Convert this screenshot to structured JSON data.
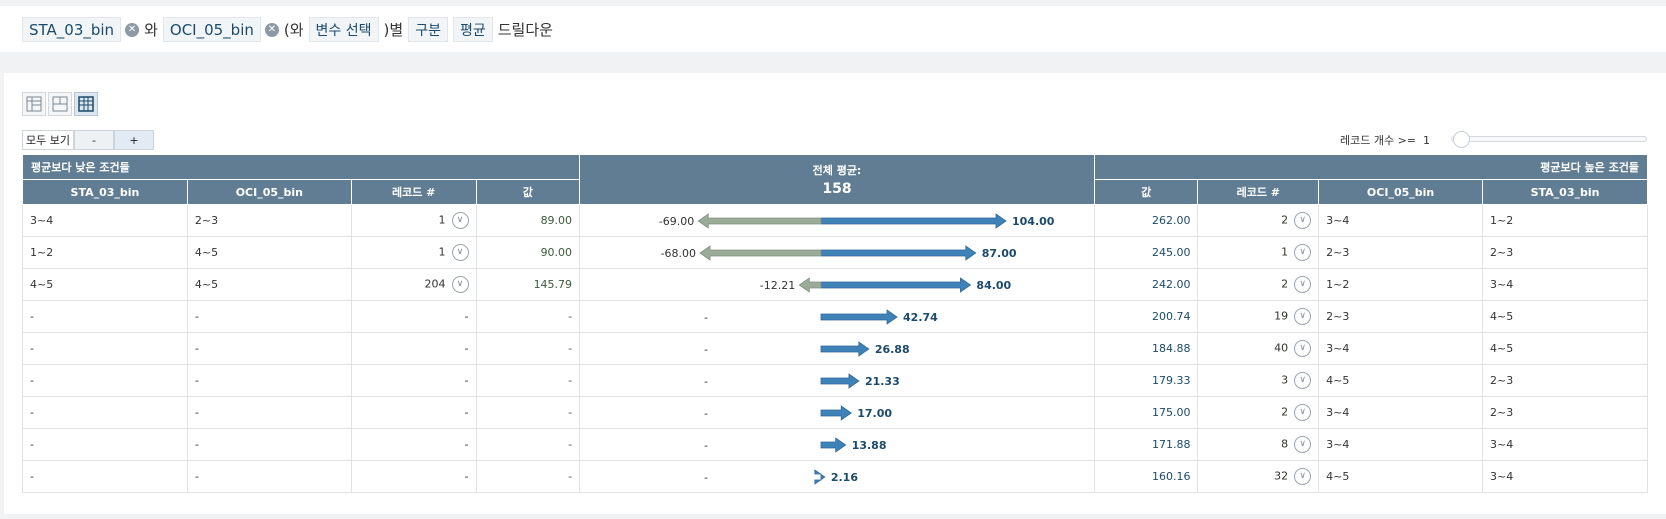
{
  "filters": {
    "var1": "STA_03_bin",
    "and1": "와",
    "var2": "OCI_05_bin",
    "and2": "(와",
    "var_select": "변수 선택",
    "by": ")별",
    "grouping": "구분",
    "mean": "평균",
    "drilldown": "드릴다운"
  },
  "controls": {
    "show_all": "모두 보기",
    "minus": "-",
    "plus": "+"
  },
  "record_filter": {
    "label": "레코드 개수 >=",
    "value": "1"
  },
  "table": {
    "low_group": "평균보다 낮은 조건들",
    "high_group": "평균보다 높은 조건들",
    "overall_label": "전체 평균:",
    "overall_value": "158",
    "cols_left": [
      "STA_03_bin",
      "OCI_05_bin",
      "레코드 #",
      "값"
    ],
    "cols_right": [
      "값",
      "레코드 #",
      "OCI_05_bin",
      "STA_03_bin"
    ],
    "rows": [
      {
        "l_sta": "3~4",
        "l_oci": "2~3",
        "l_cnt": "1",
        "l_val": "89.00",
        "low": "-69.00",
        "high": "104.00",
        "r_val": "262.00",
        "r_cnt": "2",
        "r_oci": "3~4",
        "r_sta": "1~2"
      },
      {
        "l_sta": "1~2",
        "l_oci": "4~5",
        "l_cnt": "1",
        "l_val": "90.00",
        "low": "-68.00",
        "high": "87.00",
        "r_val": "245.00",
        "r_cnt": "1",
        "r_oci": "2~3",
        "r_sta": "2~3"
      },
      {
        "l_sta": "4~5",
        "l_oci": "4~5",
        "l_cnt": "204",
        "l_val": "145.79",
        "low": "-12.21",
        "high": "84.00",
        "r_val": "242.00",
        "r_cnt": "2",
        "r_oci": "1~2",
        "r_sta": "3~4"
      },
      {
        "l_sta": "-",
        "l_oci": "-",
        "l_cnt": "-",
        "l_val": "-",
        "low": "-",
        "high": "42.74",
        "r_val": "200.74",
        "r_cnt": "19",
        "r_oci": "2~3",
        "r_sta": "4~5"
      },
      {
        "l_sta": "-",
        "l_oci": "-",
        "l_cnt": "-",
        "l_val": "-",
        "low": "-",
        "high": "26.88",
        "r_val": "184.88",
        "r_cnt": "40",
        "r_oci": "3~4",
        "r_sta": "4~5"
      },
      {
        "l_sta": "-",
        "l_oci": "-",
        "l_cnt": "-",
        "l_val": "-",
        "low": "-",
        "high": "21.33",
        "r_val": "179.33",
        "r_cnt": "3",
        "r_oci": "4~5",
        "r_sta": "2~3"
      },
      {
        "l_sta": "-",
        "l_oci": "-",
        "l_cnt": "-",
        "l_val": "-",
        "low": "-",
        "high": "17.00",
        "r_val": "175.00",
        "r_cnt": "2",
        "r_oci": "3~4",
        "r_sta": "2~3"
      },
      {
        "l_sta": "-",
        "l_oci": "-",
        "l_cnt": "-",
        "l_val": "-",
        "low": "-",
        "high": "13.88",
        "r_val": "171.88",
        "r_cnt": "8",
        "r_oci": "3~4",
        "r_sta": "3~4"
      },
      {
        "l_sta": "-",
        "l_oci": "-",
        "l_cnt": "-",
        "l_val": "-",
        "low": "-",
        "high": "2.16",
        "r_val": "160.16",
        "r_cnt": "32",
        "r_oci": "4~5",
        "r_sta": "3~4"
      }
    ]
  },
  "colors": {
    "header": "#617d93",
    "low_arrow": "#9aab9a",
    "high_arrow": "#3f82b8"
  },
  "icons": {
    "remove": "x-circle-icon",
    "expand": "chevron-down-circle-icon"
  }
}
